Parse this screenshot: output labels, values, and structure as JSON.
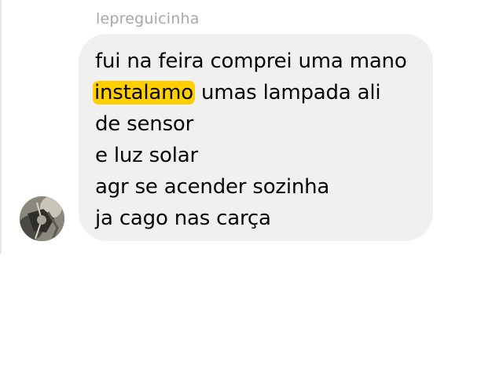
{
  "message": {
    "sender_name": "lepreguicinha",
    "avatar_icon": "profile-photo-icon",
    "lines": [
      {
        "before": "fui na feira comprei uma mano",
        "highlight": "",
        "after": ""
      },
      {
        "before": "",
        "highlight": "instalamo",
        "after": " umas lampada ali"
      },
      {
        "before": "de sensor",
        "highlight": "",
        "after": ""
      },
      {
        "before": "e luz solar",
        "highlight": "",
        "after": ""
      },
      {
        "before": "agr se acender sozinha",
        "highlight": "",
        "after": ""
      },
      {
        "before": "ja cago nas carça",
        "highlight": "",
        "after": ""
      }
    ]
  },
  "colors": {
    "bubble_bg": "#f0f0f0",
    "highlight": "#ffcf00",
    "sender_text": "#a4a7ab",
    "message_text": "#050505"
  }
}
